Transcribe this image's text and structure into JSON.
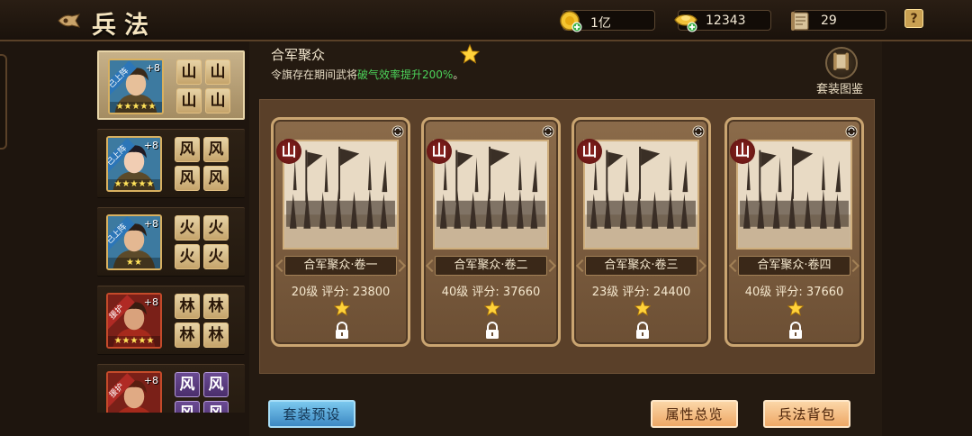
{
  "header": {
    "title": "兵法",
    "resources": [
      {
        "name": "coin-icon",
        "value": "1亿"
      },
      {
        "name": "ingot-icon",
        "value": "12343"
      },
      {
        "name": "scroll-icon",
        "value": "29"
      }
    ],
    "help": "?"
  },
  "generals": [
    {
      "badge": "已上阵",
      "level": "+8",
      "stars": "★★★★★",
      "slots": [
        "山",
        "山",
        "山",
        "山"
      ],
      "slot_style": "gold",
      "frame": "gold"
    },
    {
      "badge": "已上阵",
      "level": "+8",
      "stars": "★★★★★",
      "slots": [
        "风",
        "风",
        "风",
        "风"
      ],
      "slot_style": "gold",
      "frame": "gold"
    },
    {
      "badge": "已上阵",
      "level": "+8",
      "stars": "★★",
      "slots": [
        "火",
        "火",
        "火",
        "火"
      ],
      "slot_style": "gold",
      "frame": "gold"
    },
    {
      "badge": "援护",
      "level": "+8",
      "stars": "★★★★★",
      "slots": [
        "林",
        "林",
        "林",
        "林"
      ],
      "slot_style": "gold",
      "frame": "red"
    },
    {
      "badge": "援护",
      "level": "+8",
      "stars": "",
      "slots": [
        "风",
        "风",
        "风",
        "风"
      ],
      "slot_style": "purple",
      "frame": "red"
    }
  ],
  "selected_general": 0,
  "set": {
    "name": "合军聚众",
    "desc_prefix": "令旗存在期间武将",
    "desc_highlight": "破气效率提升200%",
    "desc_suffix": "。",
    "catalog_label": "套装图鉴"
  },
  "cards": [
    {
      "type": "山",
      "name": "合军聚众·卷一",
      "level": "20级",
      "score_label": "评分:",
      "score": "23800"
    },
    {
      "type": "山",
      "name": "合军聚众·卷二",
      "level": "40级",
      "score_label": "评分:",
      "score": "37660"
    },
    {
      "type": "山",
      "name": "合军聚众·卷三",
      "level": "23级",
      "score_label": "评分:",
      "score": "24400"
    },
    {
      "type": "山",
      "name": "合军聚众·卷四",
      "level": "40级",
      "score_label": "评分:",
      "score": "37660"
    }
  ],
  "buttons": {
    "preset": "套装预设",
    "overview": "属性总览",
    "bag": "兵法背包"
  },
  "colors": {
    "highlight": "#4cd35a",
    "gold_star": "#ffd23a",
    "preset_button": "#3c88c3",
    "action_button": "#eea866"
  }
}
